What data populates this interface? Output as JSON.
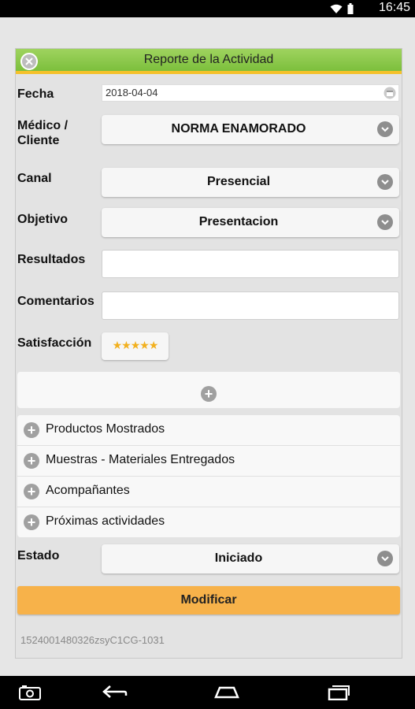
{
  "status_bar": {
    "time": "16:45"
  },
  "dialog": {
    "title": "Reporte de la Actividad",
    "fields": {
      "fecha": {
        "label": "Fecha",
        "value": "2018-04-04"
      },
      "medico": {
        "label": "Médico / Cliente",
        "value": "NORMA ENAMORADO"
      },
      "canal": {
        "label": "Canal",
        "value": "Presencial"
      },
      "objetivo": {
        "label": "Objetivo",
        "value": "Presentacion"
      },
      "resultados": {
        "label": "Resultados",
        "value": ""
      },
      "comentarios": {
        "label": "Comentarios",
        "value": ""
      },
      "satisfaccion": {
        "label": "Satisfacción",
        "stars": "★★★★★",
        "rating": 5
      },
      "estado": {
        "label": "Estado",
        "value": "Iniciado"
      }
    },
    "sections": [
      {
        "label": "Productos Mostrados"
      },
      {
        "label": "Muestras - Materiales Entregados"
      },
      {
        "label": "Acompañantes"
      },
      {
        "label": "Próximas actividades"
      }
    ],
    "modify_label": "Modificar",
    "record_id": "1524001480326zsyC1CG-1031"
  },
  "colors": {
    "header_green": "#8cc84b",
    "header_stripe": "#f5c12a",
    "button_orange": "#f7b24a",
    "star": "#f2b01e"
  }
}
